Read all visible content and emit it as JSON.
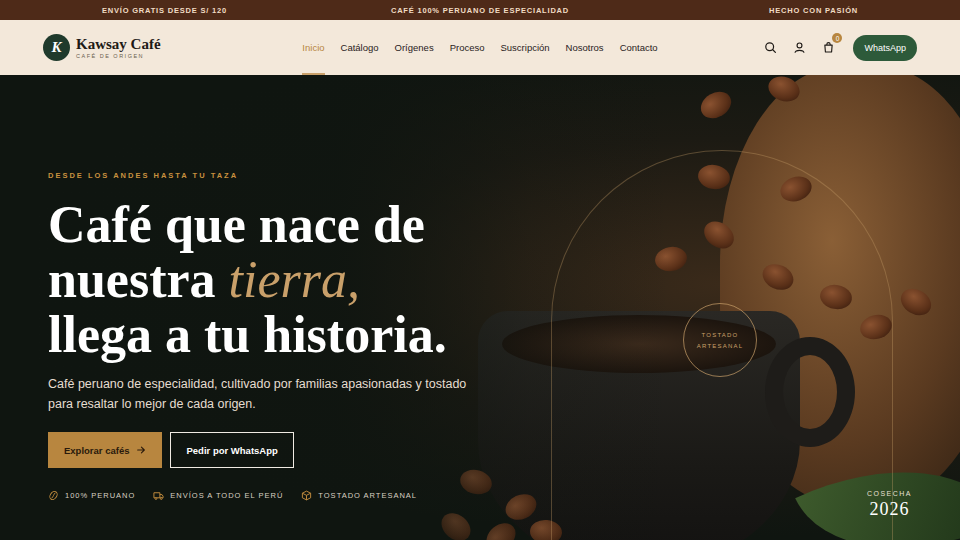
{
  "top_bar": [
    "ENVÍO GRATIS DESDE S/ 120",
    "CAFÉ 100% PERUANO DE ESPECIALIDAD",
    "HECHO CON PASIÓN"
  ],
  "brand": {
    "mark": "K",
    "name": "Kawsay Café",
    "tagline": "CAFÉ DE ORIGEN"
  },
  "nav": [
    {
      "label": "Inicio",
      "selected": true
    },
    {
      "label": "Catálogo",
      "selected": false
    },
    {
      "label": "Orígenes",
      "selected": false
    },
    {
      "label": "Proceso",
      "selected": false
    },
    {
      "label": "Suscripción",
      "selected": false
    },
    {
      "label": "Nosotros",
      "selected": false
    },
    {
      "label": "Contacto",
      "selected": false
    }
  ],
  "cart": {
    "count": "0"
  },
  "header_button": "WhatsApp",
  "hero": {
    "eyebrow": "DESDE LOS ANDES HASTA TU TAZA",
    "title": [
      [
        {
          "text": "Café que nace de",
          "accent": false
        }
      ],
      [
        {
          "text": "nuestra ",
          "accent": false
        },
        {
          "text": "tierra,",
          "accent": true
        }
      ],
      [
        {
          "text": "llega a tu historia.",
          "accent": false
        }
      ]
    ],
    "subtitle": "Café peruano de especialidad, cultivado por familias apasionadas y tostado para resaltar lo mejor de cada origen.",
    "buttons": [
      {
        "label": "Explorar cafés",
        "kind": "primary"
      },
      {
        "label": "Pedir por WhatsApp",
        "kind": "outline"
      }
    ],
    "features": [
      "100% PERUANO",
      "ENVÍOS A TODO EL PERÚ",
      "TOSTADO ARTESANAL"
    ]
  },
  "badge": [
    "TOSTADO",
    "ARTESANAL"
  ],
  "harvest": {
    "label": "COSECHA",
    "year": "2026"
  }
}
